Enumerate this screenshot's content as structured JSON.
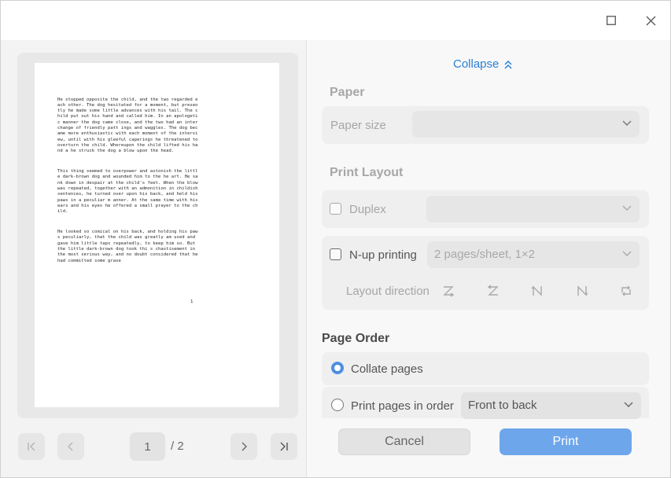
{
  "window": {
    "maximize_icon": "maximize-icon",
    "close_icon": "close-icon"
  },
  "preview": {
    "paragraphs": [
      "He stopped opposite the child, and the two regarded each other. The dog hesitated for a moment, but presently he made some little advances with his tail. The child put out his hand and called him. In an apologetic manner the dog came close, and the two had an interchange of friendly patt ings and waggles. The dog became more enthusiastic with each moment of the interview, until with his gleeful caperings he threatened to overturn the child. Whereupon the child lifted his hand a he struck the dog a blow upon the head.",
      "This thing seemed to overpower and astonish the little dark-brown dog and wounded him to the he art. He sank down in despair at the child's feet. When the blow was repeated, together with an admonition in childish sentences, he turned over upon his back, and held his paws in a peculiar m anner. At the same time with his ears and his eyes he offered a small prayer to the child.",
      "He looked so comical on his back, and holding his paws peculiarly, that the child was greatly am used and gave him little taps repeatedly, to keep him so. But the little dark-brown dog took thi s chastisement in the most serious way, and no doubt considered that he had committed some grave"
    ],
    "page_number": "1"
  },
  "pager": {
    "current": "1",
    "total": "/ 2"
  },
  "settings": {
    "collapse_label": "Collapse",
    "paper": {
      "title": "Paper",
      "size_label": "Paper size",
      "size_value": ""
    },
    "print_layout": {
      "title": "Print Layout",
      "duplex_label": "Duplex",
      "duplex_value": "",
      "nup_label": "N-up printing",
      "nup_value": "2 pages/sheet, 1×2",
      "direction_label": "Layout direction"
    },
    "page_order": {
      "title": "Page Order",
      "collate_label": "Collate pages",
      "in_order_label": "Print pages in order",
      "in_order_value": "Front to back"
    }
  },
  "actions": {
    "cancel": "Cancel",
    "print": "Print"
  },
  "colors": {
    "accent": "#2a7fd4",
    "print_button": "#6ea6ec",
    "radio_on": "#4d8fe0"
  }
}
